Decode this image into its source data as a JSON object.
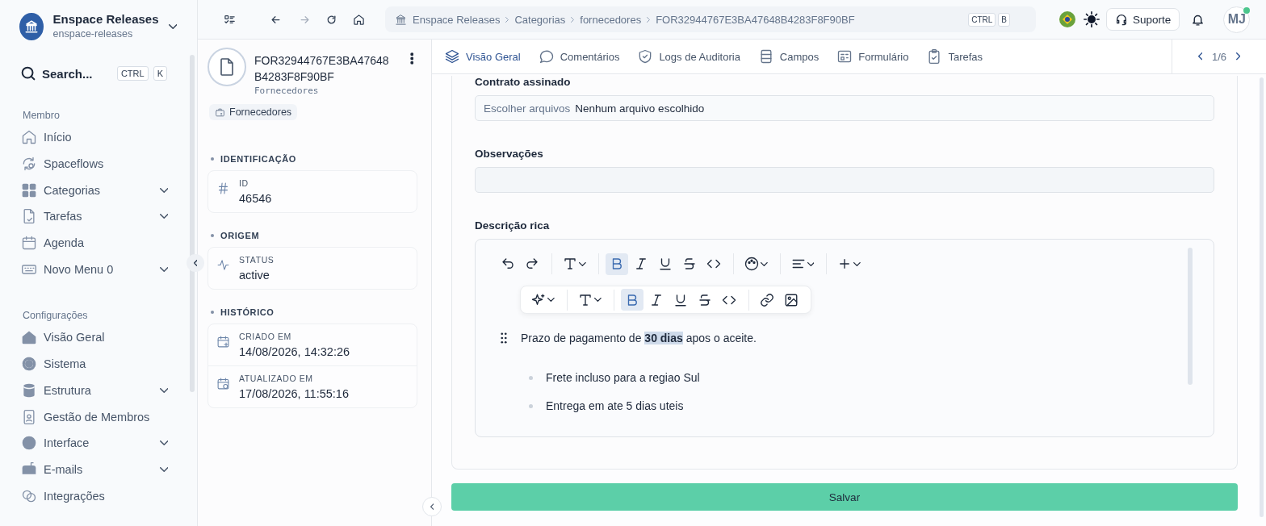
{
  "workspace": {
    "name": "Enspace Releases",
    "slug": "enspace-releases"
  },
  "search": {
    "placeholder": "Search...",
    "keys": [
      "CTRL",
      "K"
    ]
  },
  "sidebar": {
    "sections": [
      {
        "title": "Membro",
        "items": [
          {
            "label": "Início",
            "expandable": false
          },
          {
            "label": "Spaceflows",
            "expandable": false
          },
          {
            "label": "Categorias",
            "expandable": true
          },
          {
            "label": "Tarefas",
            "expandable": true
          },
          {
            "label": "Agenda",
            "expandable": false
          },
          {
            "label": "Novo Menu 0",
            "expandable": true
          }
        ]
      },
      {
        "title": "Configurações",
        "items": [
          {
            "label": "Visão Geral",
            "expandable": false
          },
          {
            "label": "Sistema",
            "expandable": false
          },
          {
            "label": "Estrutura",
            "expandable": true
          },
          {
            "label": "Gestão de Membros",
            "expandable": false
          },
          {
            "label": "Interface",
            "expandable": true
          },
          {
            "label": "E-mails",
            "expandable": true
          },
          {
            "label": "Integrações",
            "expandable": false
          }
        ]
      }
    ]
  },
  "breadcrumb": {
    "items": [
      "Enspace Releases",
      "Categorias",
      "fornecedores",
      "FOR32944767E3BA47648B4283F8F90BF"
    ],
    "keys": [
      "CTRL",
      "B"
    ]
  },
  "support_button": "Suporte",
  "user": {
    "initials": "MJ",
    "online": true
  },
  "record": {
    "title_lines": [
      "FOR32944767E3BA47648",
      "B4283F8F90BF"
    ],
    "subtitle": "Fornecedores",
    "tag": "Fornecedores",
    "sections": [
      {
        "title": "IDENTIFICAÇÃO",
        "fields": [
          {
            "label": "ID",
            "value": "46546"
          }
        ]
      },
      {
        "title": "ORIGEM",
        "fields": [
          {
            "label": "STATUS",
            "value": "active"
          }
        ]
      },
      {
        "title": "HISTÓRICO",
        "fields": [
          {
            "label": "CRIADO EM",
            "value": "14/08/2026, 14:32:26"
          },
          {
            "label": "ATUALIZADO EM",
            "value": "17/08/2026, 11:55:16"
          }
        ]
      }
    ]
  },
  "tabs": [
    {
      "label": "Visão Geral",
      "selected": true
    },
    {
      "label": "Comentários",
      "selected": false
    },
    {
      "label": "Logs de Auditoria",
      "selected": false
    },
    {
      "label": "Campos",
      "selected": false
    },
    {
      "label": "Formulário",
      "selected": false
    },
    {
      "label": "Tarefas",
      "selected": false
    }
  ],
  "pager": "1/6",
  "form": {
    "fields": [
      {
        "kind": "file",
        "label": "Contrato assinado",
        "button": "Escolher arquivos",
        "value": "Nenhum arquivo escolhido"
      },
      {
        "kind": "text",
        "label": "Observações"
      },
      {
        "kind": "rich",
        "label": "Descrição rica",
        "paragraph": "Prazo de pagamento de **30 dias** apos o aceite.",
        "bullets": [
          "Frete incluso para a regiao Sul",
          "Entrega em ate 5 dias uteis"
        ]
      }
    ],
    "submit": "Salvar"
  },
  "editor_toolbar": [
    [
      {
        "dropdown": false,
        "active": false
      },
      {
        "dropdown": false,
        "active": false
      }
    ],
    [
      {
        "dropdown": true,
        "active": false
      }
    ],
    [
      {
        "dropdown": false,
        "active": true
      },
      {
        "dropdown": false,
        "active": false
      },
      {
        "dropdown": false,
        "active": false
      },
      {
        "dropdown": false,
        "active": false
      },
      {
        "dropdown": false,
        "active": false
      }
    ],
    [
      {
        "dropdown": true,
        "active": false
      }
    ],
    [
      {
        "dropdown": true,
        "active": false
      }
    ],
    [
      {
        "dropdown": true,
        "active": false
      }
    ]
  ],
  "bubble_toolbar": [
    [
      {
        "dropdown": true,
        "active": false
      }
    ],
    [
      {
        "dropdown": true,
        "active": false
      }
    ],
    [
      {
        "dropdown": false,
        "active": true
      },
      {
        "dropdown": false,
        "active": false
      },
      {
        "dropdown": false,
        "active": false
      },
      {
        "dropdown": false,
        "active": false
      },
      {
        "dropdown": false,
        "active": false
      }
    ],
    [
      {
        "dropdown": false,
        "active": false
      },
      {
        "dropdown": false,
        "active": false
      }
    ]
  ]
}
